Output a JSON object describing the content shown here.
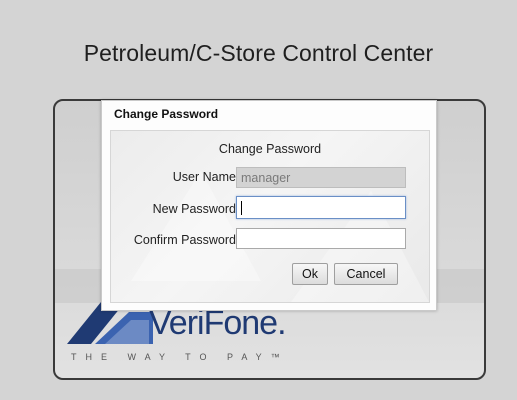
{
  "app": {
    "title": "Petroleum/C-Store Control Center"
  },
  "brand": {
    "name": "VeriFone.",
    "tagline": "THE WAY TO PAY™"
  },
  "dialog": {
    "title": "Change Password",
    "header": "Change Password",
    "fields": {
      "user_name": {
        "label": "User Name",
        "value": "manager"
      },
      "new_password": {
        "label": "New Password",
        "value": ""
      },
      "confirm_password": {
        "label": "Confirm Password",
        "value": ""
      }
    },
    "buttons": {
      "ok": "Ok",
      "cancel": "Cancel"
    }
  },
  "colors": {
    "brand_blue": "#1f3a73",
    "focus_border": "#6a8fc6"
  }
}
